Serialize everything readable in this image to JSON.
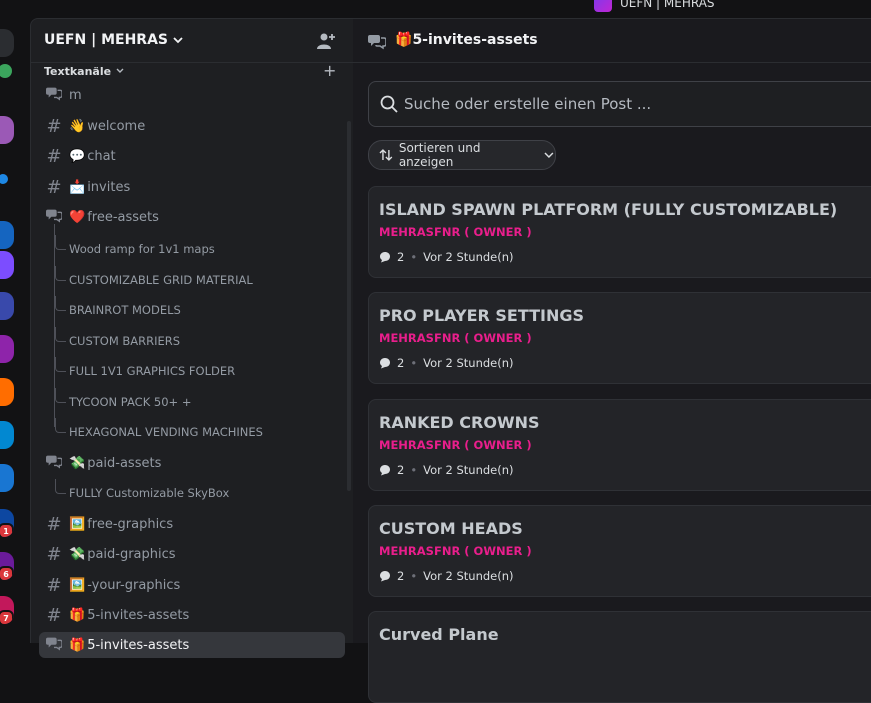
{
  "window": {
    "title": "UEFN | MEHRAS"
  },
  "server_rail": {
    "servers": [
      {
        "name": "server-1",
        "color": "#2b2d31",
        "badge": ""
      },
      {
        "name": "server-2",
        "color": "#3ba55d",
        "badge": ""
      },
      {
        "name": "server-3",
        "color": "#9b59b6",
        "badge": ""
      },
      {
        "name": "server-4",
        "color": "#1e88e5",
        "badge": ""
      },
      {
        "name": "server-5",
        "color": "#1565c0",
        "badge": ""
      },
      {
        "name": "server-6",
        "color": "#7c4dff",
        "badge": ""
      },
      {
        "name": "server-7",
        "color": "#3949ab",
        "badge": ""
      },
      {
        "name": "server-8",
        "color": "#8e24aa",
        "badge": ""
      },
      {
        "name": "server-9",
        "color": "#ff6d00",
        "badge": ""
      },
      {
        "name": "server-10",
        "color": "#0288d1",
        "badge": ""
      },
      {
        "name": "server-11",
        "color": "#1976d2",
        "badge": ""
      },
      {
        "name": "server-12",
        "color": "#0d47a1",
        "badge": "1"
      },
      {
        "name": "server-13",
        "color": "#6a1b9a",
        "badge": "6"
      },
      {
        "name": "server-14",
        "color": "#c2185b",
        "badge": "7"
      }
    ]
  },
  "sidebar": {
    "guild_name": "UEFN | MEHRAS",
    "category": "Textkanäle",
    "channels": [
      {
        "emoji": "",
        "label": "m"
      },
      {
        "emoji": "👋",
        "label": "welcome"
      },
      {
        "emoji": "💬",
        "label": "chat"
      },
      {
        "emoji": "📩",
        "label": "invites"
      },
      {
        "emoji": "❤️",
        "label": "free-assets"
      }
    ],
    "free_assets_threads": [
      "Wood ramp for 1v1 maps",
      "CUSTOMIZABLE GRID MATERIAL",
      "BRAINROT MODELS",
      "CUSTOM BARRIERS",
      "FULL 1V1 GRAPHICS FOLDER",
      "TYCOON PACK 50+ +",
      "HEXAGONAL VENDING MACHINES"
    ],
    "paid_assets": {
      "emoji": "💸",
      "label": "paid-assets"
    },
    "paid_assets_threads": [
      "FULLY Customizable SkyBox"
    ],
    "channels_after": [
      {
        "emoji": "🖼️",
        "label": "free-graphics"
      },
      {
        "emoji": "💸",
        "label": "paid-graphics"
      },
      {
        "emoji": "🖼️",
        "label": "-your-graphics"
      },
      {
        "emoji": "🎁",
        "label": "5-invites-assets"
      }
    ],
    "active_channel": {
      "emoji": "🎁",
      "label": "5-invites-assets"
    }
  },
  "main": {
    "header_emoji": "🎁",
    "header_title": "5-invites-assets",
    "search_placeholder": "Suche oder erstelle einen Post ...",
    "sort_label": "Sortieren und anzeigen",
    "posts": [
      {
        "title": "ISLAND SPAWN PLATFORM (FULLY CUSTOMIZABLE)",
        "author": "MEHRASFNR ( OWNER )",
        "replies": "2",
        "time": "Vor 2 Stunde(n)"
      },
      {
        "title": "PRO PLAYER SETTINGS",
        "author": "MEHRASFNR ( OWNER )",
        "replies": "2",
        "time": "Vor 2 Stunde(n)"
      },
      {
        "title": "RANKED CROWNS",
        "author": "MEHRASFNR ( OWNER )",
        "replies": "2",
        "time": "Vor 2 Stunde(n)"
      },
      {
        "title": "CUSTOM HEADS",
        "author": "MEHRASFNR ( OWNER )",
        "replies": "2",
        "time": "Vor 2 Stunde(n)"
      },
      {
        "title": "Curved Plane",
        "author": "",
        "replies": "",
        "time": ""
      }
    ]
  },
  "colors": {
    "accent": "#e91e8c",
    "bg": "#1e1f22"
  }
}
